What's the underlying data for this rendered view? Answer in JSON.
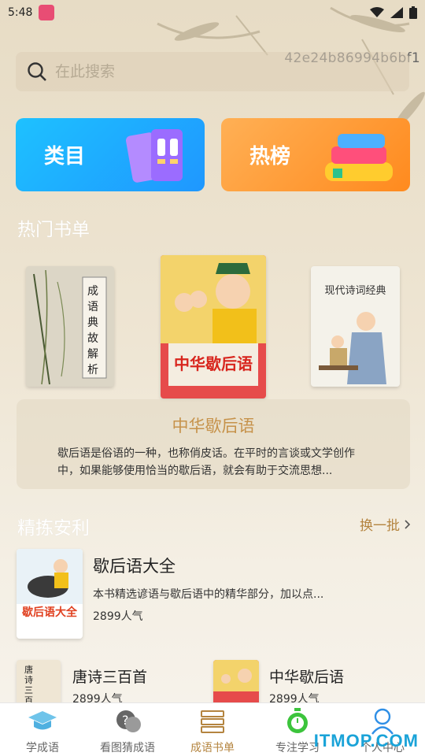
{
  "status_bar": {
    "time": "5:48"
  },
  "device_id": "42e24b86994b6bf1",
  "search": {
    "placeholder": "在此搜索"
  },
  "categories": [
    {
      "label": "类目",
      "color": "#1f9fff"
    },
    {
      "label": "热榜",
      "color": "#ff921e"
    }
  ],
  "hot_section": {
    "title": "热门书单"
  },
  "carousel": [
    {
      "cover_text": "成语典故解析"
    },
    {
      "cover_text": "中华歇后语"
    },
    {
      "cover_text": "现代诗词经典"
    }
  ],
  "featured_book": {
    "title": "中华歇后语",
    "description": "歇后语是俗语的一种，也称俏皮话。在平时的言谈或文学创作中，如果能够使用恰当的歇后语，就会有助于交流思想..."
  },
  "recommend_section": {
    "title": "精拣安利",
    "more_label": "换一批"
  },
  "recommend_main": {
    "title": "歇后语大全",
    "description": "本书精选谚语与歇后语中的精华部分，加以点...",
    "popularity": "2899人气",
    "cover_text": "歇后语大全"
  },
  "recommend_small": [
    {
      "title": "唐诗三百首",
      "popularity": "2899人气",
      "cover_text": "唐诗三百首"
    },
    {
      "title": "中华歇后语",
      "popularity": "2899人气"
    }
  ],
  "tabs": [
    {
      "label": "学成语",
      "icon": "graduation-cap-icon",
      "active": false
    },
    {
      "label": "看图猜成语",
      "icon": "question-bubble-icon",
      "active": false
    },
    {
      "label": "成语书单",
      "icon": "book-stack-icon",
      "active": true
    },
    {
      "label": "专注学习",
      "icon": "stopwatch-icon",
      "active": false
    },
    {
      "label": "个人中心",
      "icon": "person-icon",
      "active": false
    }
  ],
  "watermark": "ITMOP.COM",
  "colors": {
    "accent": "#b4843f",
    "blue_card": "#1f9fff",
    "orange_card": "#ff921e"
  }
}
